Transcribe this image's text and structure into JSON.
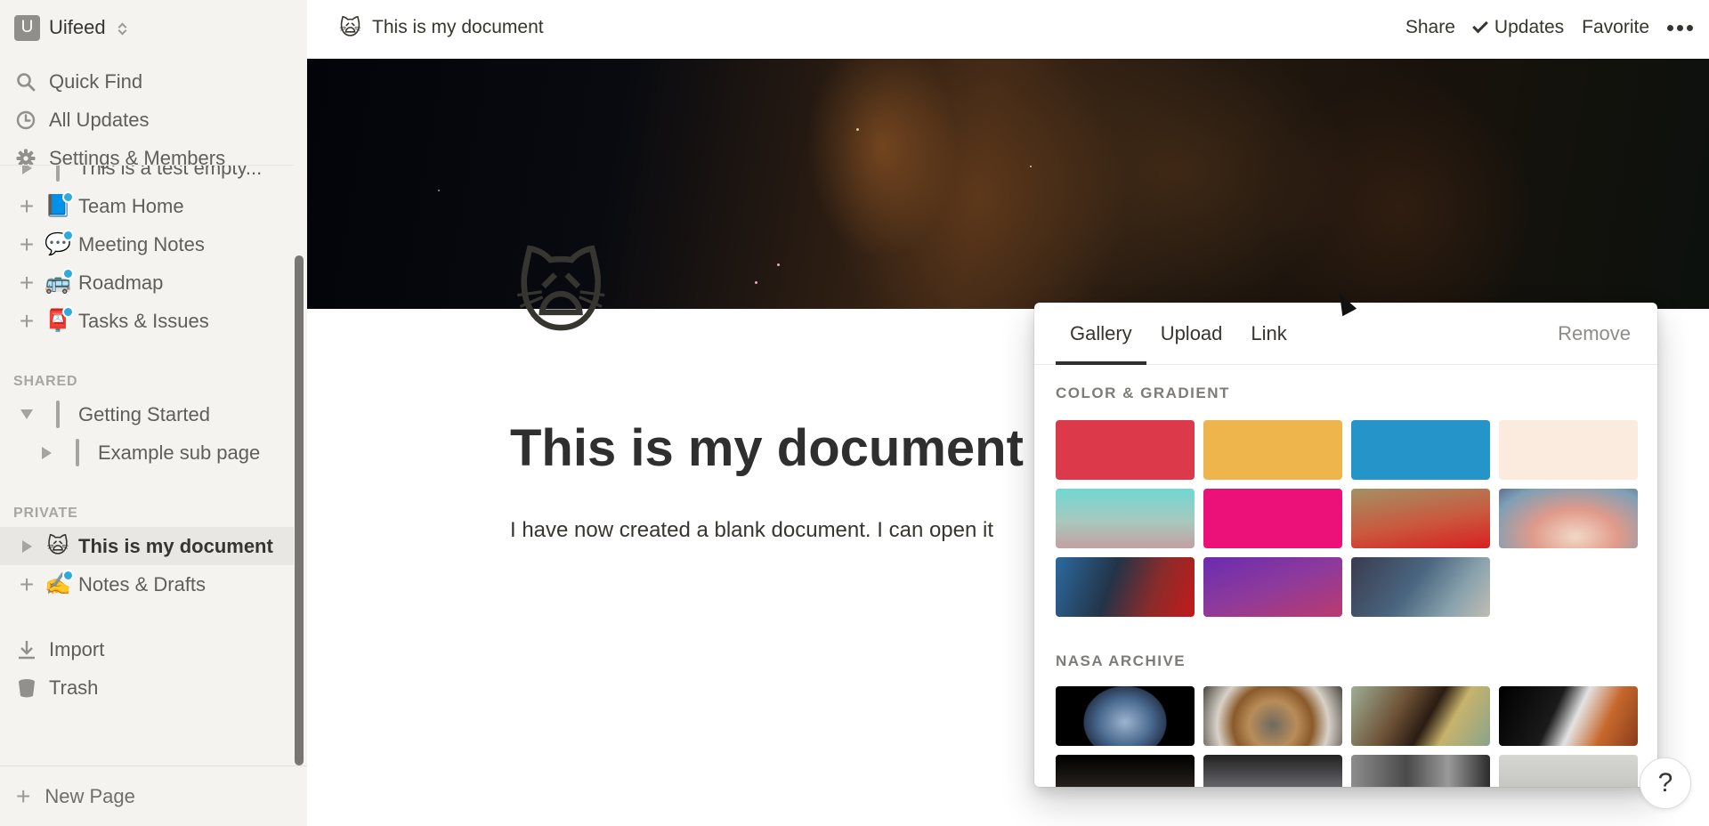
{
  "workspace": {
    "avatar_letter": "U",
    "name": "Uifeed"
  },
  "sidebar": {
    "nav": [
      {
        "label": "Quick Find",
        "icon": "search-icon"
      },
      {
        "label": "All Updates",
        "icon": "clock-icon"
      },
      {
        "label": "Settings & Members",
        "icon": "gear-icon"
      }
    ],
    "workspace_pages": [
      {
        "label": "This is a test empty...",
        "icon": "page-icon",
        "lead": "triangle-right"
      },
      {
        "label": "Team Home",
        "emoji": "📘",
        "lead": "plus",
        "badge": true
      },
      {
        "label": "Meeting Notes",
        "emoji": "💬",
        "lead": "plus",
        "badge": true
      },
      {
        "label": "Roadmap",
        "emoji": "🚌",
        "lead": "plus",
        "badge": true
      },
      {
        "label": "Tasks & Issues",
        "emoji": "📮",
        "lead": "plus",
        "badge": true
      }
    ],
    "shared_label": "SHARED",
    "shared_pages": [
      {
        "label": "Getting Started",
        "icon": "page-icon",
        "lead": "triangle-down"
      },
      {
        "label": "Example sub page",
        "icon": "page-icon",
        "lead": "triangle-right"
      }
    ],
    "private_label": "PRIVATE",
    "private_pages": [
      {
        "label": "This is my document",
        "emoji": "🙀",
        "lead": "triangle-right",
        "active": true
      },
      {
        "label": "Notes & Drafts",
        "emoji": "✍️",
        "lead": "plus",
        "badge": true
      }
    ],
    "utilities": [
      {
        "label": "Import",
        "icon": "download-icon"
      },
      {
        "label": "Trash",
        "icon": "trash-icon"
      }
    ],
    "new_page_label": "New Page"
  },
  "topbar": {
    "page_emoji": "🙀",
    "page_title": "This is my document",
    "share_label": "Share",
    "updates_label": "Updates",
    "favorite_label": "Favorite"
  },
  "document": {
    "emoji": "🙀",
    "title": "This is my document",
    "body": "I have now created a blank document. I can open it"
  },
  "cover_picker": {
    "tabs": [
      {
        "label": "Gallery",
        "active": true
      },
      {
        "label": "Upload",
        "active": false
      },
      {
        "label": "Link",
        "active": false
      }
    ],
    "remove_label": "Remove",
    "color_section_label": "COLOR & GRADIENT",
    "colors": [
      {
        "name": "solid-red",
        "fill": "#dc3a4b"
      },
      {
        "name": "solid-yellow",
        "fill": "#efb54d"
      },
      {
        "name": "solid-blue",
        "fill": "#2595c9"
      },
      {
        "name": "solid-cream",
        "fill": "#fbebdf"
      },
      {
        "name": "gradient-teal",
        "fill": "linear-gradient(180deg,#6fd8d2 0%,#a8c8bf 55%,#c4a0a0 100%)"
      },
      {
        "name": "solid-pink",
        "fill": "#eb1178"
      },
      {
        "name": "gradient-olive-red",
        "fill": "linear-gradient(170deg,#a39163 0%,#c9593f 55%,#d82020 100%)"
      },
      {
        "name": "gradient-dusk",
        "fill": "radial-gradient(ellipse at 55% 80%,#f2d8c6 0%,#e09a8a 40%,#7ea0b6 80%,#5d7290 100%)"
      },
      {
        "name": "gradient-blue-red",
        "fill": "linear-gradient(110deg,#2c6aa0 0%,#233448 40%,#8b2b2b 70%,#c41a1a 100%)"
      },
      {
        "name": "gradient-purple",
        "fill": "linear-gradient(160deg,#6a2cb0 0%,#8e3a9b 50%,#bb3b6e 100%)"
      },
      {
        "name": "gradient-slate",
        "fill": "linear-gradient(125deg,#3a3b4f 0%,#4a6680 45%,#8aa3ae 75%,#c2bdb4 100%)"
      }
    ],
    "nasa_section_label": "NASA ARCHIVE",
    "nasa_images": [
      {
        "name": "earth-from-space",
        "fill": "radial-gradient(ellipse 42% 85% at 50% 60%,#9cb4cf 0%,#4a6a8f 45%,#2a3a55 70%,#000 72%)"
      },
      {
        "name": "rocket-engine-bay",
        "fill": "radial-gradient(circle at 50% 65%,#6e6a5e 0%,#b98d5a 30%,#8a5a2a 50%,#d8d2c8 70%,#4a4640 100%)"
      },
      {
        "name": "spacecraft-frame",
        "fill": "linear-gradient(120deg,#9fae96 0%,#6d5236 35%,#2a1c12 55%,#c7b36b 70%,#8aa38b 100%)"
      },
      {
        "name": "astronaut-spacewalk",
        "fill": "linear-gradient(115deg,#000 0%,#1a1a1a 40%,#e3e3e3 55%,#c7682d 75%,#8a3d1a 100%)"
      },
      {
        "name": "lunar-module",
        "fill": "linear-gradient(180deg,#000 0%,#2a2420 60%,#6b4a2a 100%)"
      },
      {
        "name": "moon-surface-astronaut",
        "fill": "linear-gradient(180deg,#222 0%,#5a5a5f 45%,#8c8c90 100%)"
      },
      {
        "name": "mission-control",
        "fill": "linear-gradient(90deg,#8d8d8d 0%,#4a4a4a 40%,#9a9a9a 70%,#2b2b2b 100%)"
      },
      {
        "name": "wright-flyer",
        "fill": "linear-gradient(180deg,#d6d6d3 0%,#c4c4c0 60%,#9d9d98 100%)"
      }
    ]
  },
  "help_label": "?"
}
